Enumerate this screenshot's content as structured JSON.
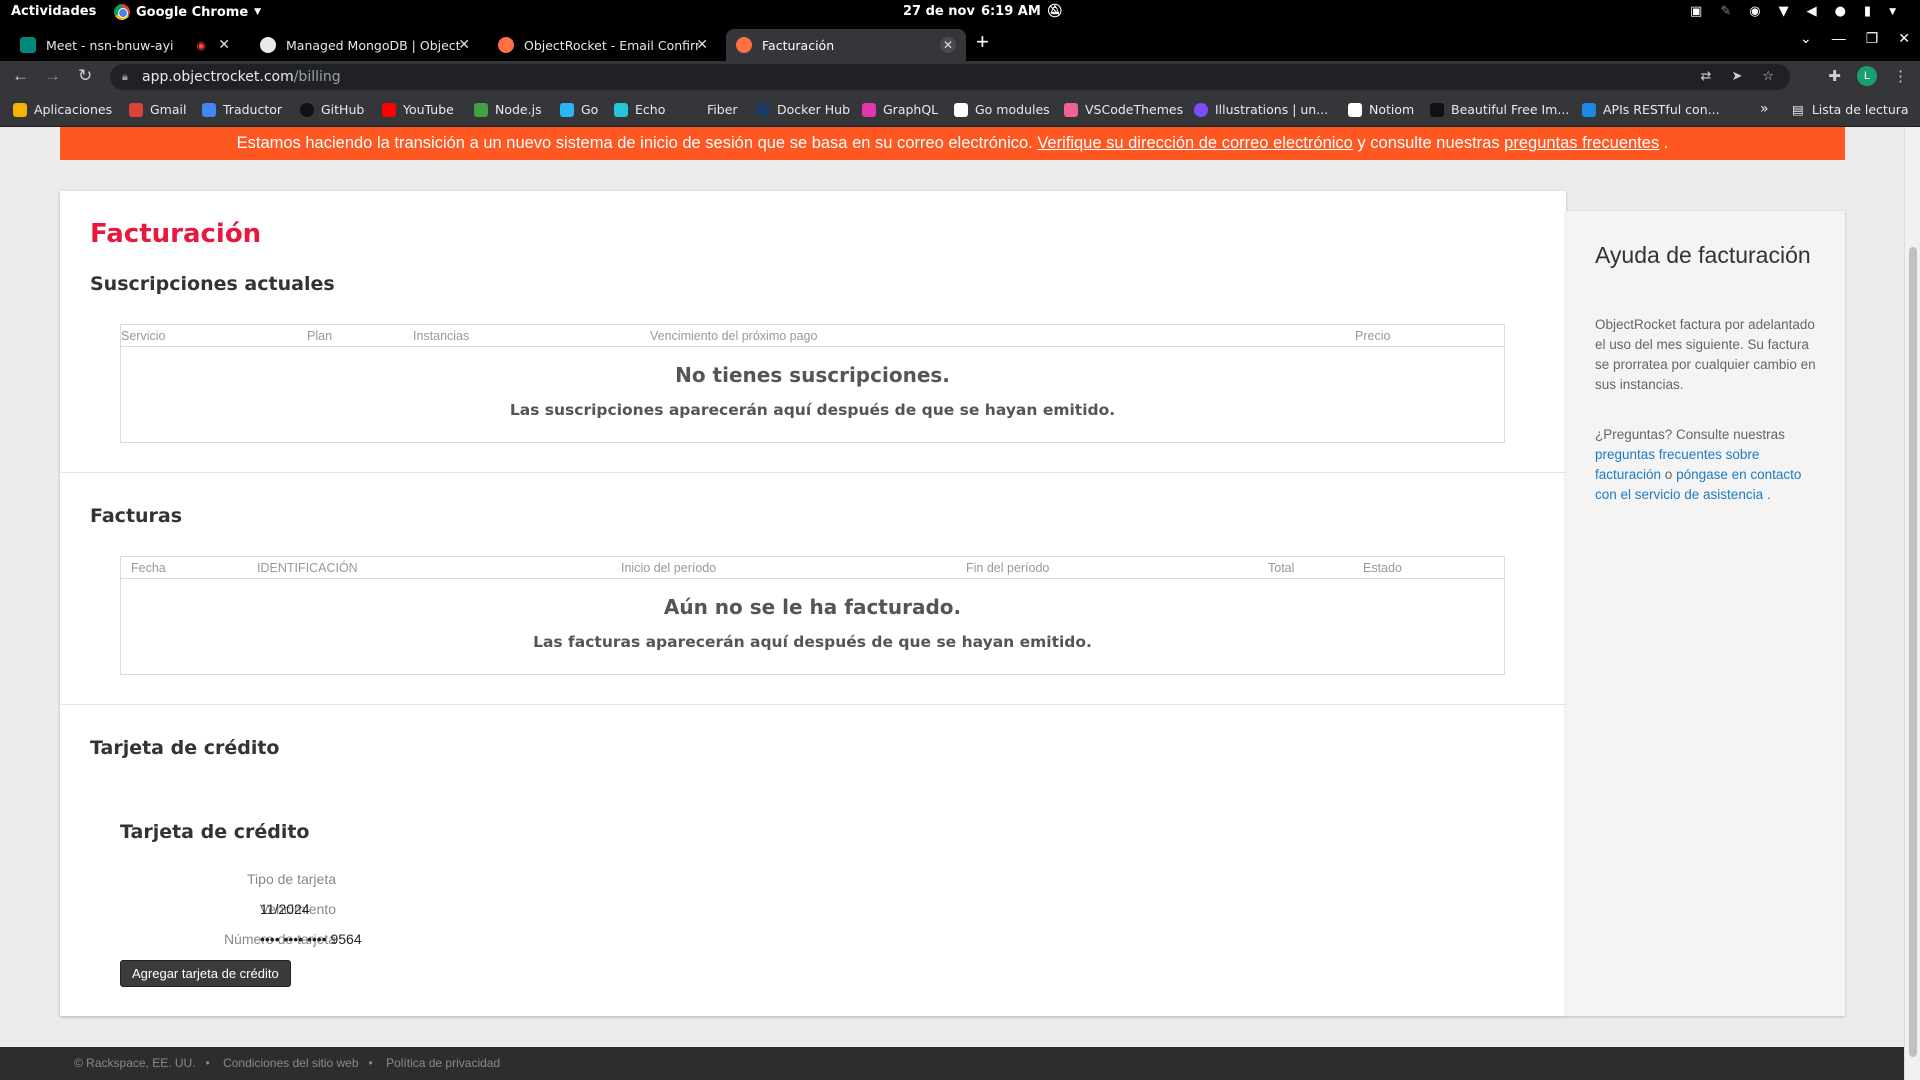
{
  "system": {
    "activities": "Actividades",
    "app_name": "Google Chrome",
    "date": "27 de nov",
    "time": "6:19 AM"
  },
  "tabs": [
    {
      "title": "Meet - nsn-bnuw-ayi",
      "favicon_color": "#00897b"
    },
    {
      "title": "Managed MongoDB | ObjectRocket",
      "favicon_color": "#e8eaed"
    },
    {
      "title": "ObjectRocket - Email Confirmation",
      "favicon_color": "#ff7043"
    },
    {
      "title": "Facturación",
      "favicon_color": "#ff7043",
      "active": true
    }
  ],
  "omnibox": {
    "host": "app.objectrocket.com",
    "path": "/billing"
  },
  "profile_initial": "L",
  "bookmarks": [
    {
      "label": "Aplicaciones",
      "icon": "apps-icon",
      "color": "#f4b400"
    },
    {
      "label": "Gmail",
      "icon": "gmail-icon",
      "color": "#db4437"
    },
    {
      "label": "Traductor",
      "icon": "translate-icon",
      "color": "#4285f4"
    },
    {
      "label": "GitHub",
      "icon": "github-icon",
      "color": "#111111"
    },
    {
      "label": "YouTube",
      "icon": "youtube-icon",
      "color": "#ff0000"
    },
    {
      "label": "Node.js",
      "icon": "nodejs-icon",
      "color": "#43a047"
    },
    {
      "label": "Go",
      "icon": "go-icon",
      "color": "#29b6f6"
    },
    {
      "label": "Echo",
      "icon": "echo-icon",
      "color": "#26c6da"
    },
    {
      "label": "Fiber",
      "icon": "fiber-icon",
      "color": "#35363a"
    },
    {
      "label": "Docker Hub",
      "icon": "docker-icon",
      "color": "#1e3a5f"
    },
    {
      "label": "GraphQL",
      "icon": "graphql-icon",
      "color": "#e535ab"
    },
    {
      "label": "Go modules",
      "icon": "notion-icon",
      "color": "#ffffff"
    },
    {
      "label": "VSCodeThemes",
      "icon": "vscodethemes-icon",
      "color": "#f06292"
    },
    {
      "label": "Illustrations | un...",
      "icon": "illustrations-icon",
      "color": "#7c4dff"
    },
    {
      "label": "Notiom",
      "icon": "notion-icon",
      "color": "#ffffff"
    },
    {
      "label": "Beautiful Free Im...",
      "icon": "unsplash-icon",
      "color": "#111111"
    },
    {
      "label": "APIs RESTful con...",
      "icon": "apis-icon",
      "color": "#1e88e5"
    }
  ],
  "reading_list": "Lista de lectura",
  "banner": {
    "text_before": "Estamos haciendo la transición a un nuevo sistema de inicio de sesión que se basa en su correo electrónico. ",
    "link1": "Verifique su dirección de correo electrónico",
    "text_mid": " y consulte nuestras ",
    "link2": "preguntas frecuentes",
    "text_after": " ."
  },
  "billing": {
    "title": "Facturación",
    "subscriptions": {
      "heading": "Suscripciones actuales",
      "columns": [
        "Servicio",
        "Plan",
        "Instancias",
        "Vencimiento del próximo pago",
        "Precio"
      ],
      "empty_title": "No tienes suscripciones.",
      "empty_sub": "Las suscripciones aparecerán aquí después de que se hayan emitido."
    },
    "invoices": {
      "heading": "Facturas",
      "columns": [
        "Fecha",
        "IDENTIFICACIÓN",
        "Inicio del período",
        "Fin del período",
        "Total",
        "Estado"
      ],
      "empty_title": "Aún no se le ha facturado.",
      "empty_sub": "Las facturas aparecerán aquí después de que se hayan emitido."
    },
    "credit_card": {
      "heading": "Tarjeta de crédito",
      "subheading": "Tarjeta de crédito",
      "type_label": "Tipo de tarjeta",
      "type_value": "",
      "expiry_label": "Vencimiento",
      "expiry_value": "11/2024",
      "number_label": "Número de tarjeta",
      "number_value": "•••• •••• •••• 9564",
      "button": "Agregar tarjeta de crédito"
    }
  },
  "help": {
    "title": "Ayuda de facturación",
    "p1": "ObjectRocket factura por adelantado el uso del mes siguiente. Su factura se prorratea por cualquier cambio en sus instancias.",
    "p2_text": "¿Preguntas? Consulte nuestras ",
    "p2_link1": "preguntas frecuentes sobre facturación",
    "p2_or": " o ",
    "p2_link2": "póngase en contacto con el servicio de asistencia",
    "p2_end": " ."
  },
  "footer": {
    "copyright": "© Rackspace, EE. UU.",
    "terms": "Condiciones del sitio web",
    "privacy": "Política de privacidad"
  }
}
